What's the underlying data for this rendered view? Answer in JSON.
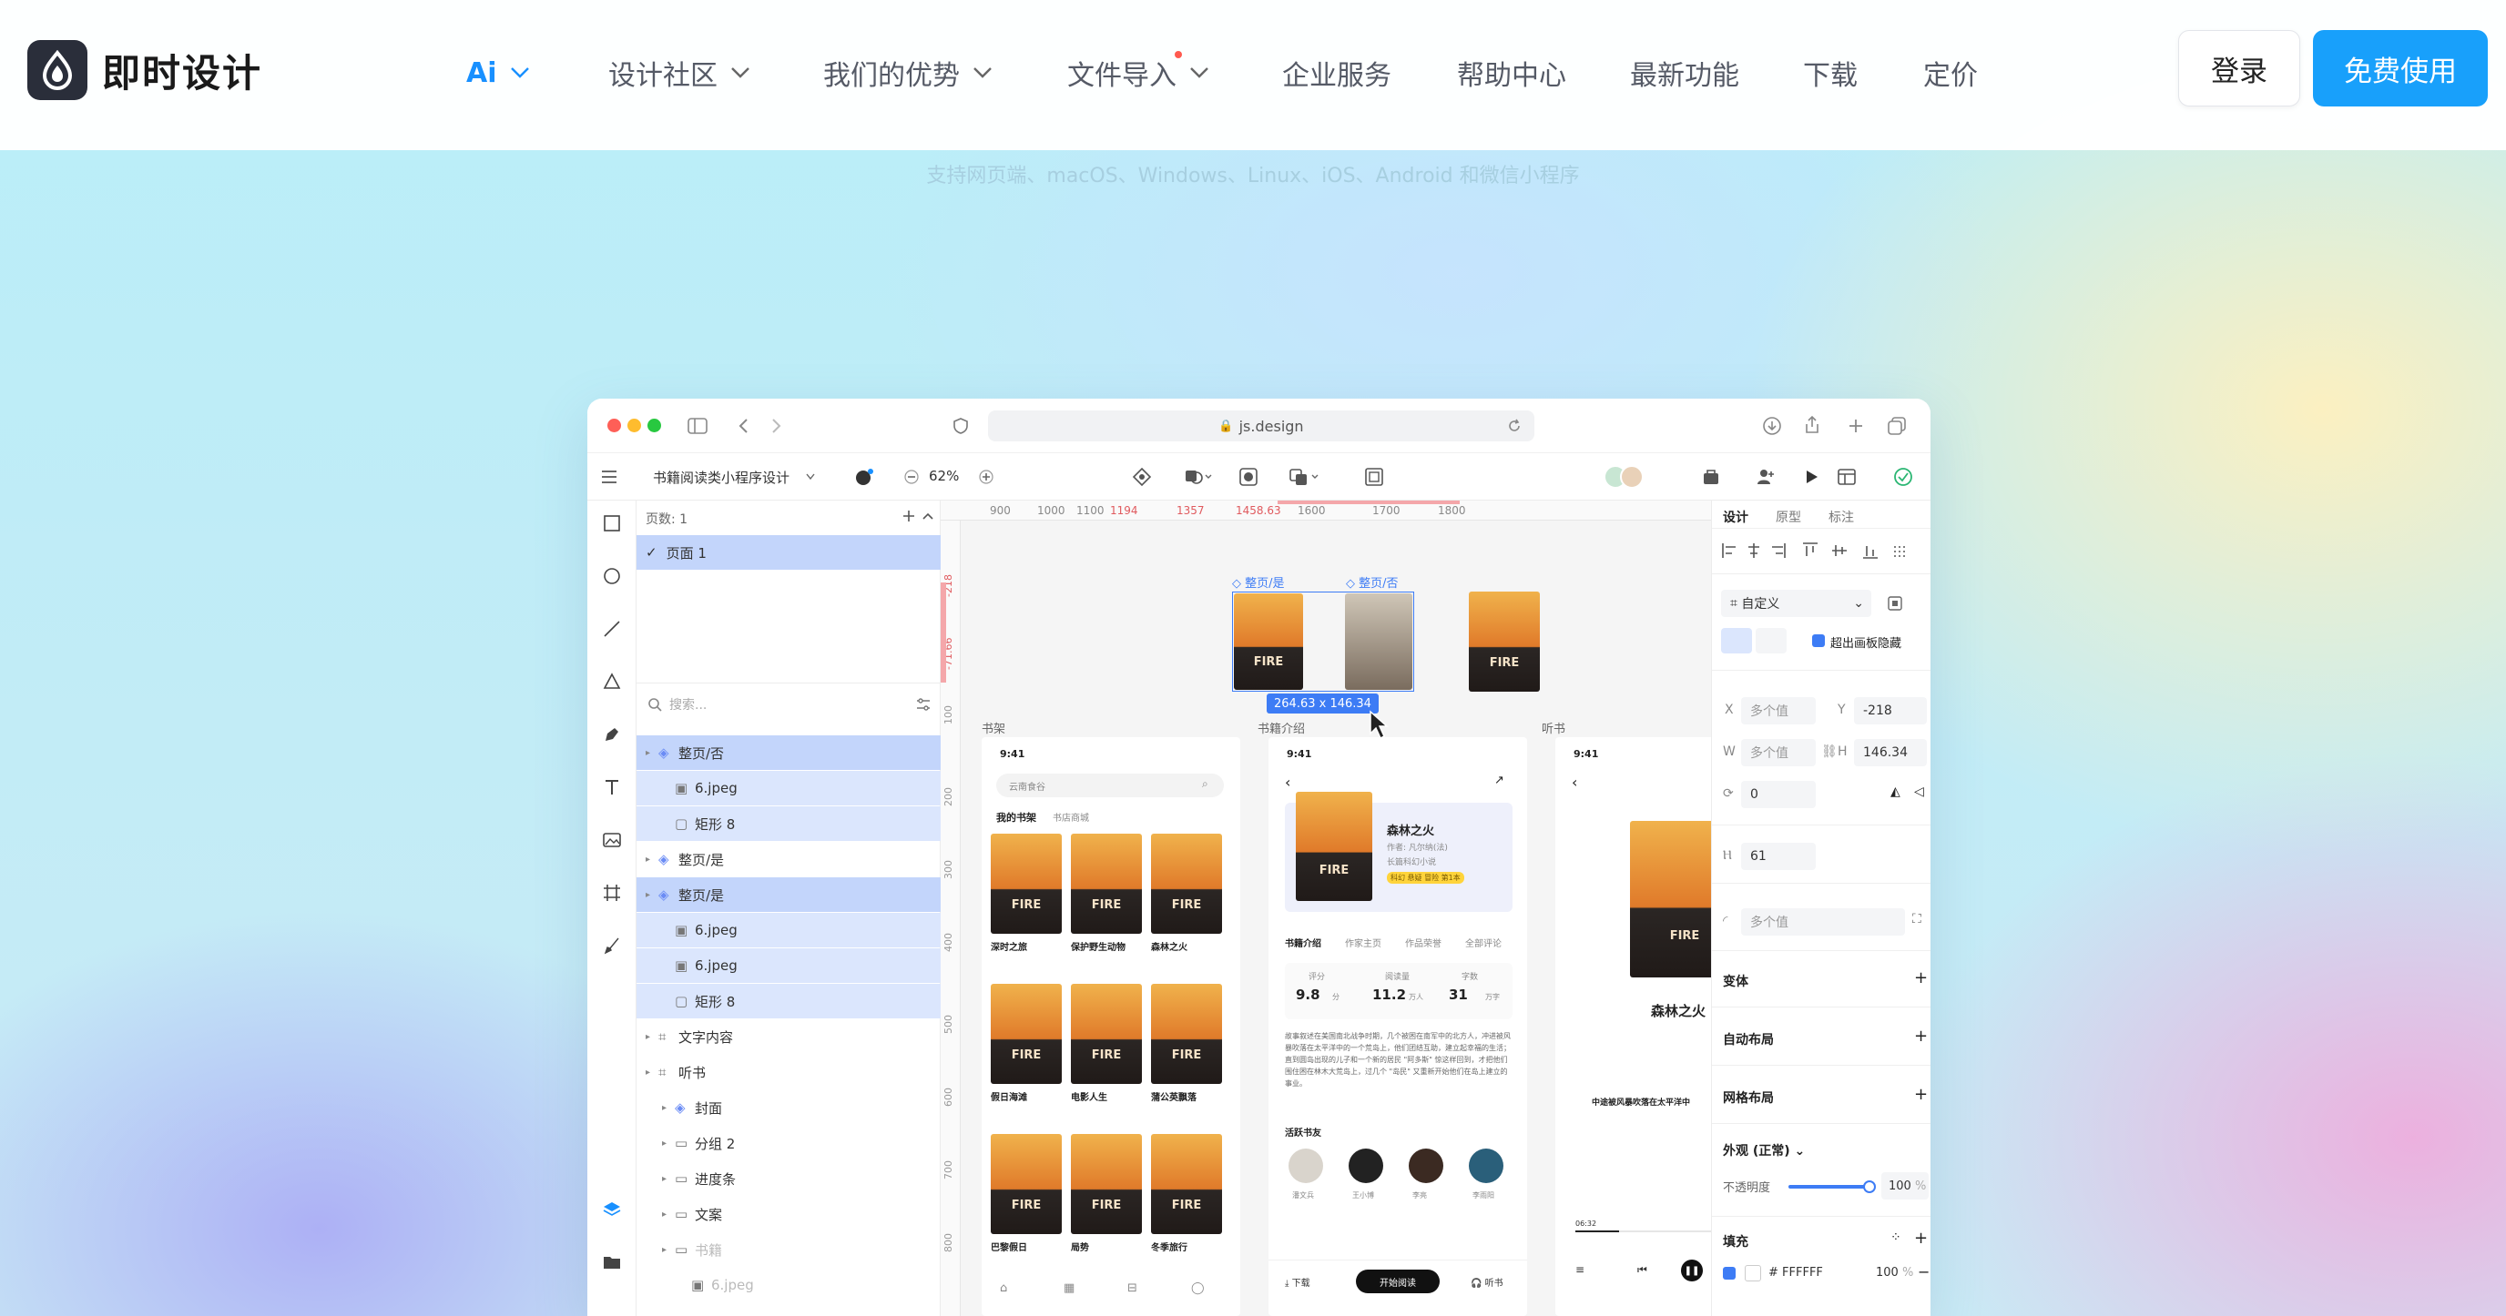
{
  "brand": {
    "name": "即时设计"
  },
  "nav": {
    "items": [
      {
        "label": "Ai",
        "dropdown": true
      },
      {
        "label": "设计社区",
        "dropdown": true
      },
      {
        "label": "我们的优势",
        "dropdown": true
      },
      {
        "label": "文件导入",
        "dropdown": true,
        "dot": true
      },
      {
        "label": "企业服务",
        "dropdown": false
      },
      {
        "label": "帮助中心",
        "dropdown": false
      },
      {
        "label": "最新功能",
        "dropdown": false
      },
      {
        "label": "下载",
        "dropdown": false
      },
      {
        "label": "定价",
        "dropdown": false
      }
    ],
    "login": "登录",
    "free": "免费使用"
  },
  "hero": {
    "platforms": "支持网页端、macOS、Windows、Linux、iOS、Android 和微信小程序"
  },
  "app": {
    "url": "js.design",
    "file_name": "书籍阅读类小程序设计",
    "zoom": "62%",
    "pages_label": "页数: 1",
    "page_name": "页面 1",
    "search_placeholder": "搜索...",
    "layers": [
      {
        "label": "整页/否",
        "depth": 0,
        "kind": "component",
        "state": "sel-strong"
      },
      {
        "label": "6.jpeg",
        "depth": 1,
        "kind": "image",
        "state": "sel"
      },
      {
        "label": "矩形 8",
        "depth": 1,
        "kind": "rect",
        "state": "sel"
      },
      {
        "label": "整页/是",
        "depth": 0,
        "kind": "component",
        "state": ""
      },
      {
        "label": "整页/是",
        "depth": 0,
        "kind": "component",
        "state": "sel-strong"
      },
      {
        "label": "6.jpeg",
        "depth": 1,
        "kind": "image",
        "state": "sel"
      },
      {
        "label": "6.jpeg",
        "depth": 1,
        "kind": "image",
        "state": "sel"
      },
      {
        "label": "矩形 8",
        "depth": 1,
        "kind": "rect",
        "state": "sel"
      },
      {
        "label": "文字内容",
        "depth": 0,
        "kind": "frame",
        "state": ""
      },
      {
        "label": "听书",
        "depth": 0,
        "kind": "frame",
        "state": ""
      },
      {
        "label": "封面",
        "depth": 1,
        "kind": "component",
        "state": ""
      },
      {
        "label": "分组 2",
        "depth": 1,
        "kind": "group",
        "state": ""
      },
      {
        "label": "进度条",
        "depth": 1,
        "kind": "group",
        "state": ""
      },
      {
        "label": "文案",
        "depth": 1,
        "kind": "group",
        "state": ""
      },
      {
        "label": "书籍",
        "depth": 1,
        "kind": "group",
        "state": "faded"
      },
      {
        "label": "6.jpeg",
        "depth": 2,
        "kind": "image",
        "state": "faded"
      }
    ],
    "ruler_ticks": [
      "900",
      "1000",
      "1100",
      "1194",
      "1357",
      "1458.63",
      "1600",
      "1700",
      "1800"
    ],
    "ruler_ticks_left": [
      "-218",
      "-71.66",
      "100",
      "200",
      "300",
      "400",
      "500",
      "600",
      "700",
      "800"
    ],
    "canvas": {
      "sel_label_1": "整页/是",
      "sel_label_2": "整页/否",
      "size_badge": "264.63 x 146.34",
      "frame_shelf": "书架",
      "frame_intro": "书籍介绍",
      "frame_listen": "听书",
      "time": "9:41",
      "shelf_search": "云南食谷",
      "shelf_tab1": "我的书架",
      "shelf_tab2": "书店商城",
      "books": [
        "深时之旅",
        "保护野生动物",
        "森林之火",
        "假日海滩",
        "电影人生",
        "蒲公英飘落",
        "巴黎假日",
        "局势",
        "冬季旅行"
      ],
      "book_title": "森林之火",
      "book_author": "作者: 凡尔纳(法)",
      "book_meta": "长篇科幻小说",
      "book_tags": "科幻 悬疑 冒险 第1本",
      "intro_tabs": [
        "书籍介绍",
        "作家主页",
        "作品荣誉",
        "全部评论"
      ],
      "stats": [
        {
          "label": "评分",
          "value": "9.8",
          "unit": "分"
        },
        {
          "label": "阅读量",
          "value": "11.2",
          "unit": "万人"
        },
        {
          "label": "字数",
          "value": "31",
          "unit": "万字"
        }
      ],
      "desc": "故事叙述在美国南北战争时期，几个被困在南军中的北方人，冲进被风暴吹落在太平洋中的一个荒岛上，他们团结互助，建立起幸福的生活；直到圆岛出现的儿子和一个新的居民 \"阿多斯\" 惊这样回到，才把他们围住困在林木大荒岛上，过几个 \"岛民\" 又重新开始他们在岛上建立的事业。",
      "readers_title": "活跃书友",
      "readers": [
        "潘文兵",
        "王小博",
        "李亮",
        "李雨阳"
      ],
      "btn_download": "下载",
      "btn_read": "开始阅读",
      "btn_listen": "听书",
      "listen_title": "森林之火",
      "listen_sub": "中途被风暴吹落在太平洋中",
      "listen_time": "06:32"
    },
    "props": {
      "tabs": [
        "设计",
        "原型",
        "标注"
      ],
      "frame_type": "自定义",
      "clip_label": "超出画板隐藏",
      "x_label": "X",
      "x_value": "多个值",
      "y_label": "Y",
      "y_value": "-218",
      "w_label": "W",
      "w_value": "多个值",
      "h_label": "H",
      "h_value": "146.34",
      "rotation": "0",
      "spacing": "61",
      "radius": "多个值",
      "variants": "变体",
      "auto_layout": "自动布局",
      "grid_layout": "网格布局",
      "appearance": "外观 (正常)",
      "opacity_label": "不透明度",
      "opacity_value": "100",
      "opacity_unit": "%",
      "fill": "填充",
      "fill_hex": "FFFFFF",
      "fill_opacity": "100",
      "fill_unit": "%"
    }
  },
  "colors": {
    "accent": "#18a0fb",
    "selection": "#dbe6fd",
    "ai": "#1890ff"
  }
}
